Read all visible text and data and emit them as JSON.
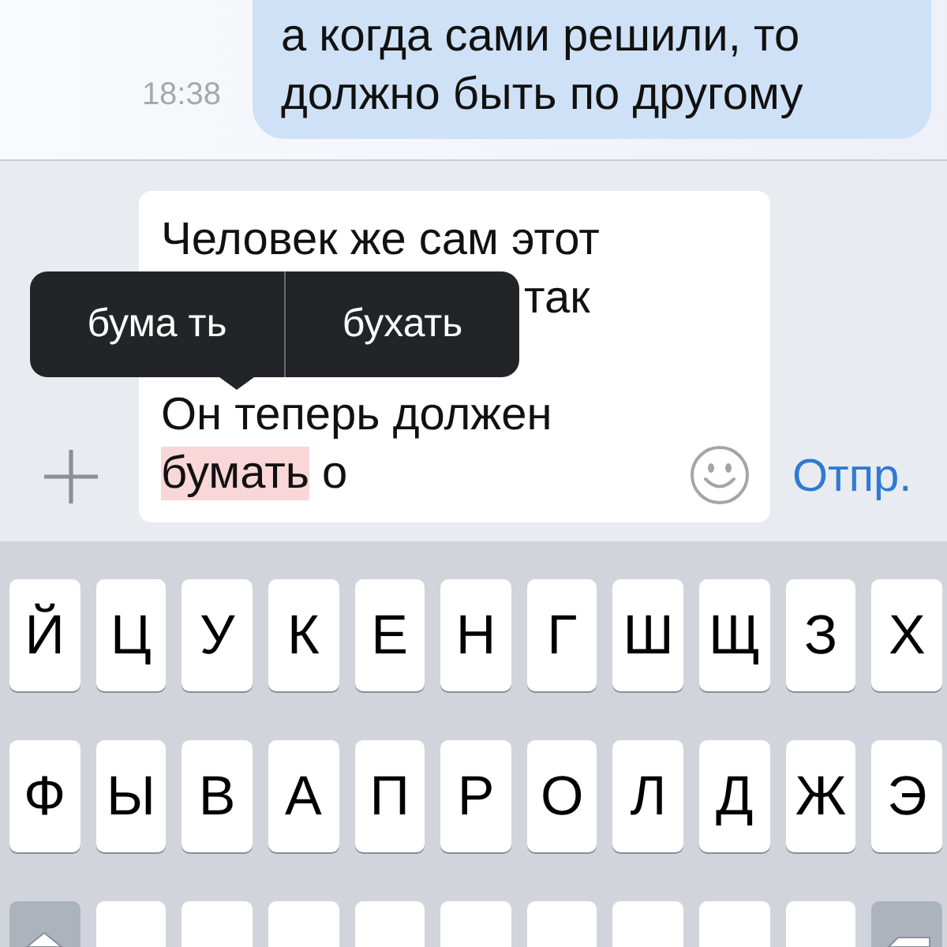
{
  "chat": {
    "message": {
      "time": "18:38",
      "lines": [
        "а когда сами решили, то",
        "должно быть по другому"
      ]
    }
  },
  "draft": {
    "lines": [
      {
        "kind": "full",
        "segments": [
          {
            "text": "Человек же сам этот",
            "misspelled": false
          }
        ]
      },
      {
        "kind": "covered_start",
        "segments": [
          {
            "text": "так",
            "misspelled": false
          }
        ]
      },
      {
        "kind": "covered"
      },
      {
        "kind": "full",
        "segments": [
          {
            "text": "Он теперь должен",
            "misspelled": false
          }
        ]
      },
      {
        "kind": "full",
        "segments": [
          {
            "text": "бумать",
            "misspelled": true
          },
          {
            "text": "о",
            "misspelled": false
          }
        ]
      }
    ]
  },
  "suggestions": [
    {
      "text": "бума ть",
      "selected": false
    },
    {
      "text": "бухать",
      "selected": false
    }
  ],
  "send_label": "Отпр.",
  "keyboard": {
    "rows": [
      [
        "Й",
        "Ц",
        "У",
        "К",
        "Е",
        "Н",
        "Г",
        "Ш",
        "Щ",
        "З",
        "Х"
      ],
      [
        "Ф",
        "Ы",
        "В",
        "А",
        "П",
        "Р",
        "О",
        "Л",
        "Д",
        "Ж",
        "Э"
      ]
    ],
    "partial_row": [
      {
        "kind": "shift"
      },
      {
        "kind": "letter"
      },
      {
        "kind": "letter"
      },
      {
        "kind": "letter"
      },
      {
        "kind": "letter"
      },
      {
        "kind": "letter"
      },
      {
        "kind": "letter"
      },
      {
        "kind": "letter"
      },
      {
        "kind": "letter"
      },
      {
        "kind": "letter"
      },
      {
        "kind": "delete"
      }
    ]
  }
}
